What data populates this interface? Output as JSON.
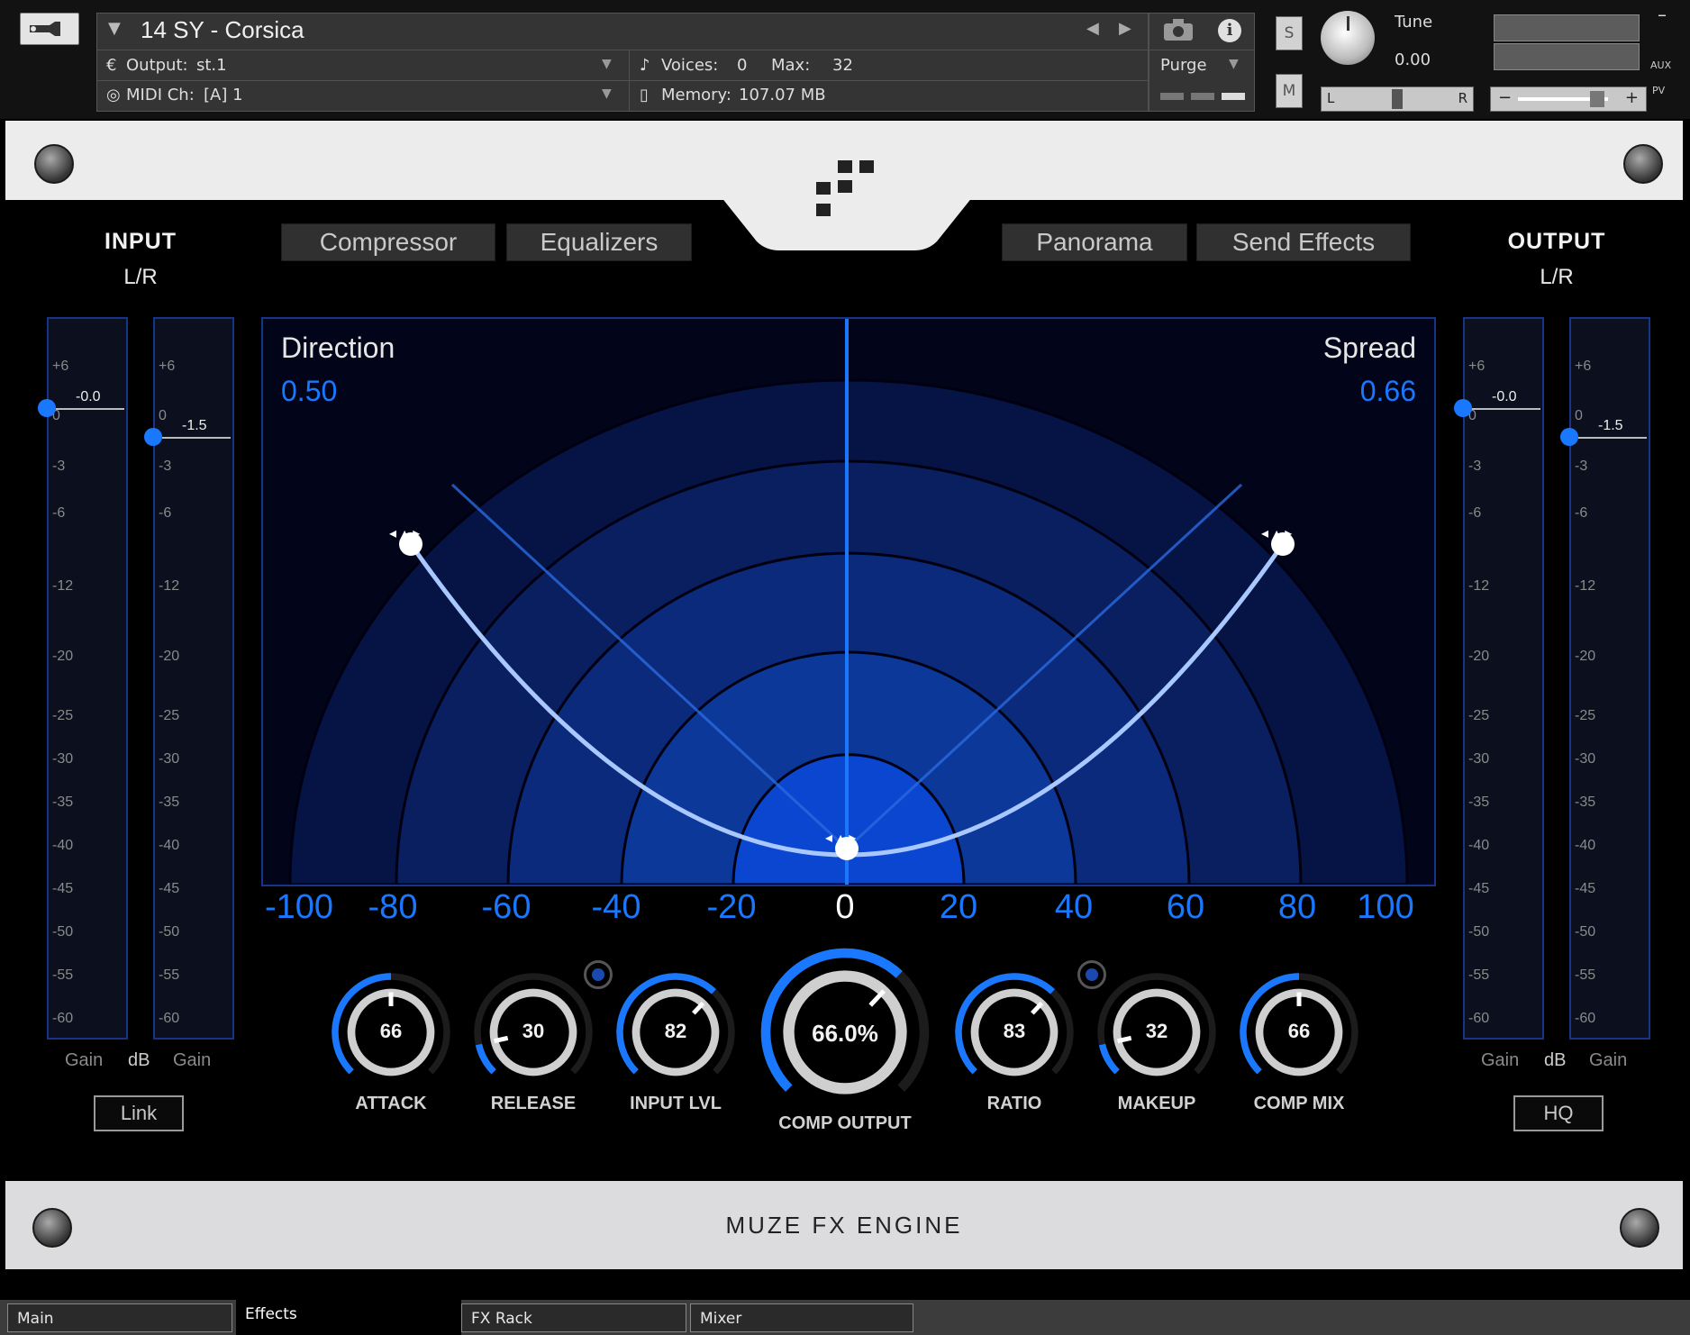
{
  "header": {
    "instrument_title": "14 SY - Corsica",
    "output_label": "Output:",
    "output_value": "st.1",
    "voices_label": "Voices:",
    "voices_value": "0",
    "max_label": "Max:",
    "max_value": "32",
    "midi_label": "MIDI Ch:",
    "midi_value": "[A]  1",
    "memory_label": "Memory:",
    "memory_value": "107.07 MB",
    "purge_label": "Purge",
    "solo_label": "S",
    "mute_label": "M",
    "tune_label": "Tune",
    "tune_value": "0.00",
    "pan_left": "L",
    "pan_right": "R",
    "vol_minus": "−",
    "vol_plus": "+",
    "aux_label": "AUX",
    "pv_label": "PV",
    "minimize_label": "–"
  },
  "tabs": {
    "compressor": "Compressor",
    "equalizers": "Equalizers",
    "panorama": "Panorama",
    "send_effects": "Send Effects"
  },
  "input": {
    "title": "INPUT",
    "subtitle": "L/R",
    "left_value": "-0.0",
    "right_value": "-1.5",
    "gain_left": "Gain",
    "db": "dB",
    "gain_right": "Gain",
    "link_label": "Link"
  },
  "output": {
    "title": "OUTPUT",
    "subtitle": "L/R",
    "left_value": "-0.0",
    "right_value": "-1.5",
    "gain_left": "Gain",
    "db": "dB",
    "gain_right": "Gain",
    "hq_label": "HQ"
  },
  "meter_ticks": [
    "+6",
    "0",
    "-3",
    "-6",
    "-12",
    "-20",
    "-25",
    "-30",
    "-35",
    "-40",
    "-45",
    "-50",
    "-55",
    "-60"
  ],
  "panorama": {
    "direction_label": "Direction",
    "direction_value": "0.50",
    "spread_label": "Spread",
    "spread_value": "0.66",
    "axis": [
      "-100",
      "-80",
      "-60",
      "-40",
      "-20",
      "0",
      "20",
      "40",
      "60",
      "80",
      "100"
    ]
  },
  "knobs": [
    {
      "id": "attack",
      "label": "ATTACK",
      "value": "66",
      "fraction": 0.5
    },
    {
      "id": "release",
      "label": "RELEASE",
      "value": "30",
      "fraction": 0.12
    },
    {
      "id": "input-lvl",
      "label": "INPUT LVL",
      "value": "82",
      "fraction": 0.66
    },
    {
      "id": "comp-output",
      "label": "COMP OUTPUT",
      "value": "66.0%",
      "fraction": 0.66
    },
    {
      "id": "ratio",
      "label": "RATIO",
      "value": "83",
      "fraction": 0.66
    },
    {
      "id": "makeup",
      "label": "MAKEUP",
      "value": "32",
      "fraction": 0.12
    },
    {
      "id": "comp-mix",
      "label": "COMP MIX",
      "value": "66",
      "fraction": 0.5
    }
  ],
  "footer": {
    "brand": "MUZE FX ENGINE"
  },
  "bottom_tabs": [
    "Main",
    "Effects",
    "FX Rack",
    "Mixer"
  ],
  "colors": {
    "accent_blue": "#1a78ff",
    "meter_border": "#18348a",
    "background": "#000000"
  }
}
